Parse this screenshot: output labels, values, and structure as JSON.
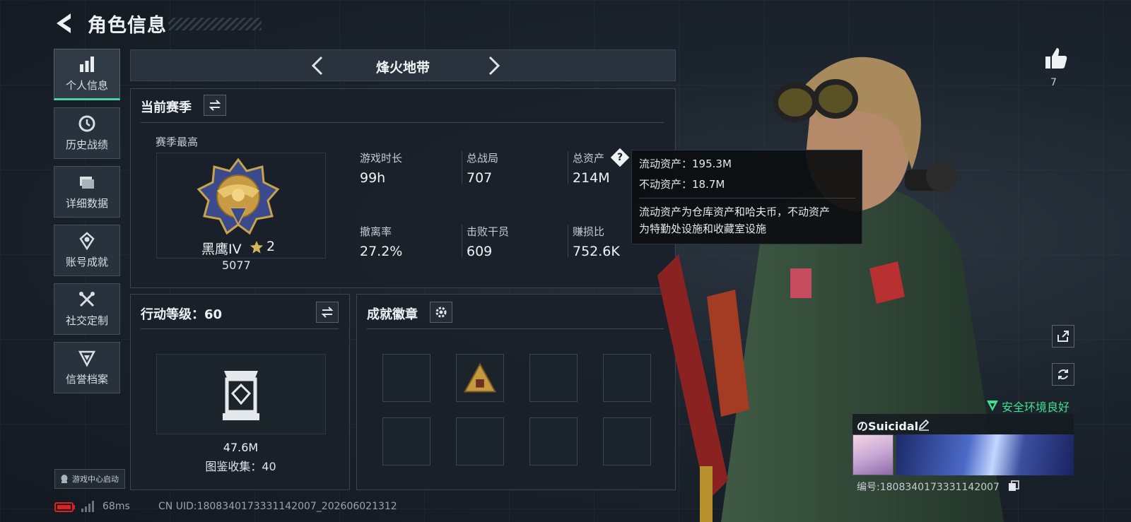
{
  "header": {
    "title": "角色信息"
  },
  "sidebar": {
    "items": [
      {
        "label": "个人信息",
        "icon": "bar-chart-icon",
        "active": true
      },
      {
        "label": "历史战绩",
        "icon": "clock-icon"
      },
      {
        "label": "详细数据",
        "icon": "folder-icon"
      },
      {
        "label": "账号成就",
        "icon": "badge-icon"
      },
      {
        "label": "社交定制",
        "icon": "tools-icon"
      },
      {
        "label": "信誉档案",
        "icon": "shield-icon"
      }
    ]
  },
  "mode": {
    "name": "烽火地带"
  },
  "season": {
    "title": "当前赛季",
    "best_label": "赛季最高",
    "rank_name": "黑鹰IV",
    "rank_stars": "2",
    "rank_points": "5077",
    "stats": [
      {
        "label": "游戏时长",
        "value": "99h"
      },
      {
        "label": "总战局",
        "value": "707"
      },
      {
        "label": "总资产",
        "value": "214M"
      },
      {
        "label": "撤离率",
        "value": "27.2%"
      },
      {
        "label": "击败干员",
        "value": "609"
      },
      {
        "label": "赚损比",
        "value": "752.6K"
      }
    ]
  },
  "tooltip": {
    "line1": "流动资产：195.3M",
    "line2": "不动资产：18.7M",
    "desc1": "流动资产为仓库资产和哈夫币，不动资产",
    "desc2": "为特勤处设施和收藏室设施"
  },
  "action_level": {
    "title": "行动等级：60",
    "collection_value": "47.6M",
    "collection_label": "图鉴收集：40"
  },
  "achievements": {
    "title": "成就徽章"
  },
  "likes": {
    "count": "7"
  },
  "safety": {
    "text": "安全环境良好"
  },
  "player": {
    "name": "のSuicidal",
    "id_text": "编号:1808340173331142007"
  },
  "footer": {
    "game_center": "游戏中心启动",
    "ping": "68ms",
    "uid": "CN UID:1808340173331142007_202606021312"
  },
  "colors": {
    "accent": "#4fd3a6",
    "safety": "#3fe08c",
    "battery": "#e02020"
  }
}
